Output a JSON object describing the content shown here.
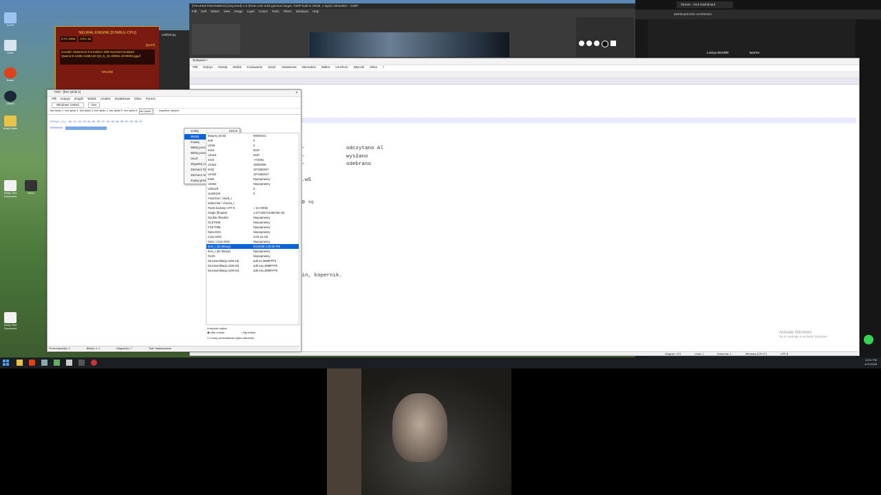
{
  "desktop": {
    "icons": [
      "Ta PC",
      "Kosz",
      "Nowy folder",
      "Brave",
      "Steam",
      "Nowy Text Document",
      "hamburger",
      "Hmm",
      "Nowy Text Document"
    ]
  },
  "neural": {
    "title": "NEURAL ENGINE [STABLE-CPU]",
    "ctx": "CTX 4096",
    "cpu": "CPU 16",
    "lines": [
      "Goodel: Statement-Formalizer 32B-SonnetAnnotated",
      "Qwen3.5-122B-A10B-UD-Q3_K_XL-00001-of-00003.gguf"
    ],
    "status": "ONLINE",
    "quit": "[QUIT]"
  },
  "gimp": {
    "title": "[*INASINSTNSONMESS] (imported)-1.0 (RGB color 8-bit gamma integer, GIMP built-in sRGB, 1 layer) 1664x802 – GIMP",
    "menu": [
      "File",
      "Edit",
      "Select",
      "View",
      "Image",
      "Layer",
      "Colors",
      "Tools",
      "Filters",
      "Windows",
      "Help"
    ]
  },
  "browser": {
    "tab": "Stream - Kick Dashboard",
    "url": "dashboard.kick.com/stream",
    "user": "LuckyLuke1980",
    "follows": "tworms"
  },
  "editor": {
    "title": "Notepad++",
    "menu": [
      "Plik",
      "Edycja",
      "Szukaj",
      "Widok",
      "Kodowanie",
      "Język",
      "Ustawienia",
      "Narzędzia",
      "Makra",
      "Uruchom",
      "Wtyczki",
      "Okna",
      "?"
    ],
    "lines": [
      {
        "a": "--",
        "b": "odczytano Al"
      },
      {
        "a": "--",
        "b": "wysłano"
      },
      {
        "a": "--",
        "b": "odebrano"
      },
      {
        "a": "G.wS",
        "b": ""
      },
      {
        "a": "=0 =c",
        "b": ""
      },
      {
        "a": "sin, kopernik.",
        "b": ""
      }
    ],
    "status": [
      "Długość: 474",
      "Linii: 42",
      "Linia: 1",
      "Kolumna: 1",
      "Zaznaczenie: 0 | 0",
      "Windows (CR LF)",
      "UTF-8",
      "INS"
    ],
    "activate": [
      "Activate Windows",
      "Go to Settings to activate Windows."
    ]
  },
  "hxd": {
    "title": "HxD - [bez tytułu 1]",
    "menu": [
      "Plik",
      "Edycja",
      "Znajdź",
      "Widok",
      "Analiza",
      "Dodatkowe",
      "Okno",
      "Pomoc"
    ],
    "encoding": "Windows (ANSI)",
    "hexmode": "hex",
    "tabs": [
      "bez tytułu 1",
      "bez tytułu 2",
      "bez tytułu 3",
      "bez tytułu 4",
      "bez tytułu 5",
      "bez tytułu 6",
      "bez tytułu 7"
    ],
    "inspector_tab": "Inspektor danych",
    "offset_label": "Offset (h)",
    "hex_header": "00 01 02 03 04 05 06 07 08 09 0A 0B 0C 0D 0E 0F",
    "offset": "00000000",
    "context_menu": [
      {
        "label": "Cofnij",
        "key": "Ctrl+Z"
      },
      {
        "label": "Wytnij",
        "key": "Ctrl+X"
      },
      {
        "label": "Kopiuj",
        "key": "Ctrl+C"
      },
      {
        "label": "Wklej przez wstawienie",
        "key": "Ctrl+V"
      },
      {
        "label": "Wklej przez nadpisanie",
        "key": "Ctrl+B"
      },
      {
        "label": "Usuń",
        "key": "Del"
      },
      {
        "label": "Wypełnij zaznaczenie...",
        "key": ""
      },
      {
        "label": "Zaznacz blok...",
        "key": "Ctrl+E"
      },
      {
        "label": "Zaznacz wszystko",
        "key": "Ctrl+A"
      },
      {
        "label": "Kopiuj przesunięcie",
        "key": "Alt+Ins"
      }
    ],
    "inspector": [
      {
        "k": "Binarny (8 bit)",
        "v": "00000101"
      },
      {
        "k": "Int8",
        "v": "5"
      },
      {
        "k": "UInt8",
        "v": "5"
      },
      {
        "k": "Int16",
        "v": "8197"
      },
      {
        "k": "UInt16",
        "v": "8197"
      },
      {
        "k": "Int24",
        "v": "-772091"
      },
      {
        "k": "UInt24",
        "v": "16005095"
      },
      {
        "k": "Int32",
        "v": "16*1562547"
      },
      {
        "k": "UInt32",
        "v": "16*1562547"
      },
      {
        "k": "Int64",
        "v": "Niepoprawny"
      },
      {
        "k": "UInt64",
        "v": "Niepoprawny"
      },
      {
        "k": "LEB128",
        "v": "5"
      },
      {
        "k": "ULEB128",
        "v": "5"
      },
      {
        "k": "AnsiChar / char8_t",
        "v": ""
      },
      {
        "k": "WideChar / char16_t",
        "v": ""
      },
      {
        "k": "Punkt kodowy UTF-8",
        "v": "□ (U+0005)"
      },
      {
        "k": "Single (float32)",
        "v": "1,57732571448875E-38"
      },
      {
        "k": "Double (float64)",
        "v": "Niepoprawny"
      },
      {
        "k": "OLETIME",
        "v": "Niepoprawny"
      },
      {
        "k": "FILETIME",
        "v": "Niepoprawny"
      },
      {
        "k": "Data DOS",
        "v": "Niepoprawny"
      },
      {
        "k": "Czas DOS",
        "v": "4:02:10 AM"
      },
      {
        "k": "Data i Czas DOS",
        "v": "Niepoprawny"
      },
      {
        "k": "time_t (32 bitowy)",
        "v": "5/1/2038 2:28:35 PM"
      },
      {
        "k": "time_t (64 bitowy)",
        "v": "Niepoprawny"
      },
      {
        "k": "GUID",
        "v": "Niepoprawny"
      },
      {
        "k": "Dezasemblacja (x86-16)",
        "v": "add ax,3698FFF5"
      },
      {
        "k": "Dezasemblacja (x86-32)",
        "v": "add eax,3698FFF5"
      },
      {
        "k": "Dezasemblacja (x86-64)",
        "v": "add eax,3698FFF5"
      }
    ],
    "byte_order_label": "Kolejność bajtów",
    "little": "Little endian",
    "big": "Big endian",
    "hex_int": "Liczby szesnastkowe (tylko całkowite)",
    "status": [
      "Przesunięcie(h): 0",
      "Blok(h): 1-7",
      "Długość(h): 7",
      "Tryb: Nadpisywanie"
    ]
  },
  "taskbar": {
    "time": "12:51 PM",
    "date": "4/21/2026"
  }
}
